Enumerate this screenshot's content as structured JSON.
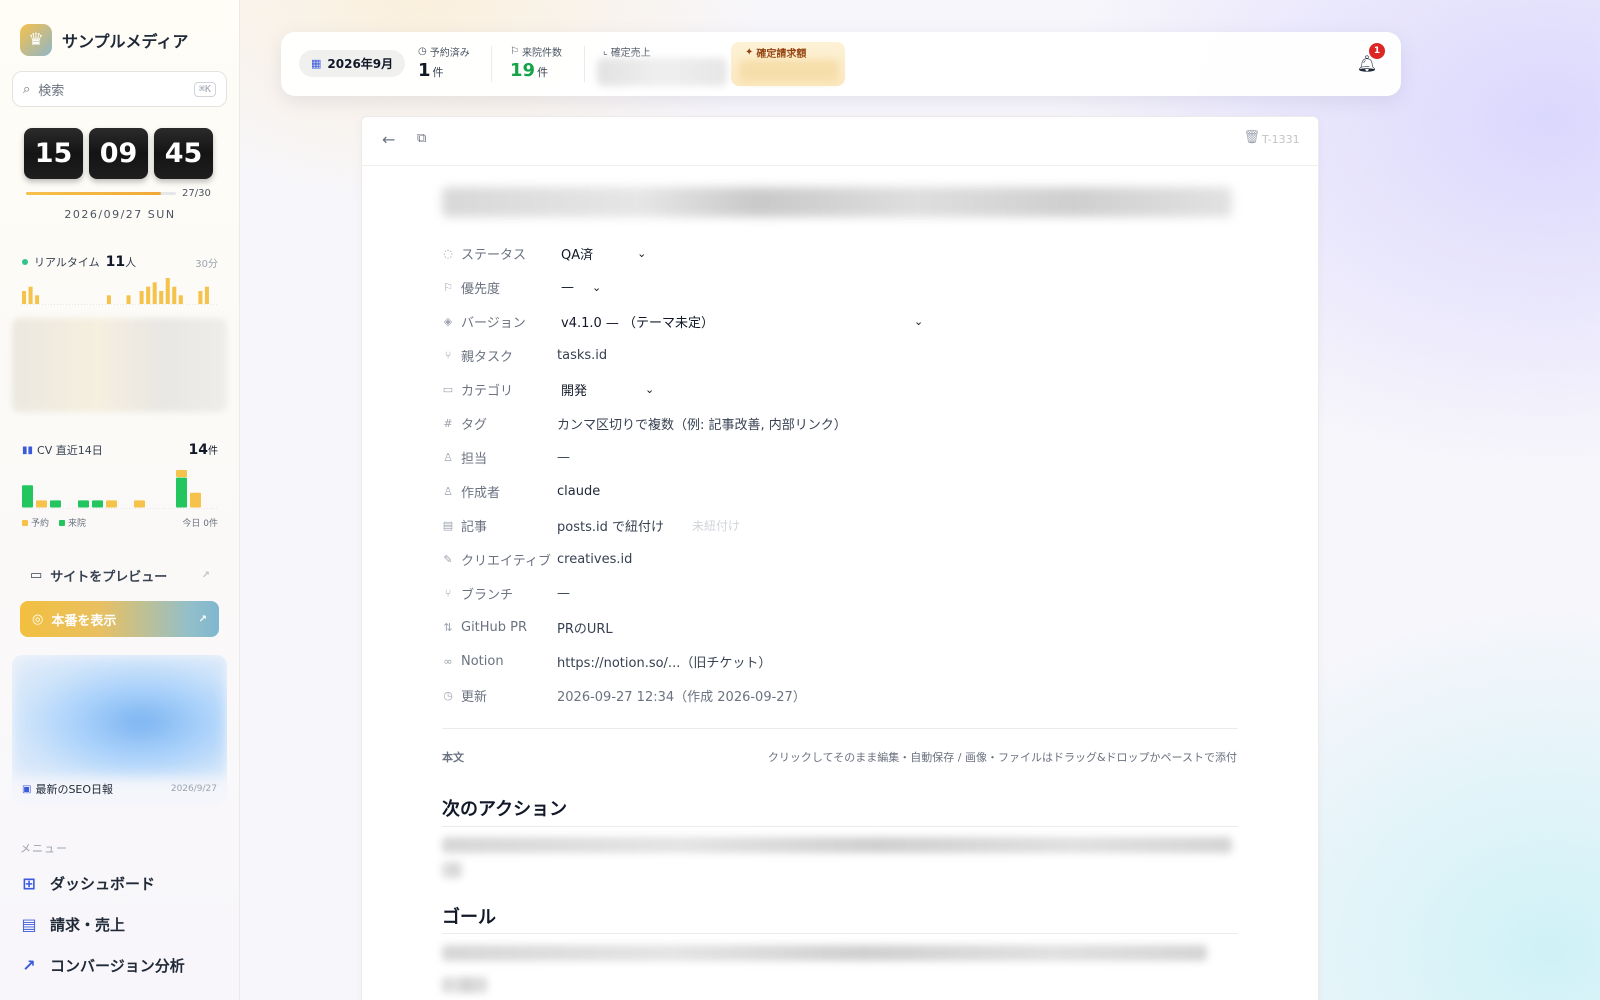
{
  "brand": {
    "name": "サンプルメディア"
  },
  "search": {
    "placeholder": "検索",
    "shortcut": "⌘K"
  },
  "clock": {
    "hours": "15",
    "minutes": "09",
    "seconds": "45"
  },
  "month_progress": {
    "label": "27/30",
    "fraction": 0.9
  },
  "date": "2026/09/27 SUN",
  "realtime": {
    "label": "リアルタイム",
    "count": "11",
    "unit": "人",
    "window": "30分",
    "color": "#f5c24c",
    "bars": [
      3,
      4,
      2,
      0,
      0,
      0,
      0,
      0,
      0,
      0,
      0,
      0,
      0,
      2,
      0,
      0,
      2,
      0,
      3,
      4,
      5,
      3,
      6,
      4,
      2,
      0,
      0,
      3,
      4,
      0
    ]
  },
  "cv": {
    "label": "CV 直近14日",
    "total": "14",
    "unit": "件",
    "legend_reserve": "予約",
    "legend_visit": "来院",
    "today_label": "今日 0件",
    "reserve_color": "#f5c24c",
    "visit_color": "#22c55e",
    "days": [
      {
        "visit": 3,
        "reserve": 0
      },
      {
        "visit": 0,
        "reserve": 1
      },
      {
        "visit": 1,
        "reserve": 0
      },
      {
        "visit": 0,
        "reserve": 0
      },
      {
        "visit": 1,
        "reserve": 0
      },
      {
        "visit": 1,
        "reserve": 0
      },
      {
        "visit": 0,
        "reserve": 1
      },
      {
        "visit": 0,
        "reserve": 0
      },
      {
        "visit": 0,
        "reserve": 1
      },
      {
        "visit": 0,
        "reserve": 0
      },
      {
        "visit": 0,
        "reserve": 0
      },
      {
        "visit": 4,
        "reserve": 1
      },
      {
        "visit": 0,
        "reserve": 2
      },
      {
        "visit": 0,
        "reserve": 0
      }
    ]
  },
  "site_preview": {
    "label": "サイトをプレビュー"
  },
  "production": {
    "label": "本番を表示"
  },
  "seo_card": {
    "title": "最新のSEO日報",
    "date": "2026/9/27"
  },
  "menu": {
    "label": "メニュー",
    "items": [
      {
        "label": "ダッシュボード",
        "icon": "grid-icon"
      },
      {
        "label": "請求・売上",
        "icon": "invoice-icon"
      },
      {
        "label": "コンバージョン分析",
        "icon": "chart-line-icon"
      }
    ]
  },
  "topbar": {
    "month": "2026年9月",
    "reserved": {
      "label": "予約済み",
      "value": "1",
      "unit": "件"
    },
    "visits": {
      "label": "来院件数",
      "value": "19",
      "unit": "件"
    },
    "confirmed_sales": {
      "label": "確定売上"
    },
    "confirmed_billing": {
      "label": "確定請求額"
    },
    "notifications": "1"
  },
  "task": {
    "id": "T-1331",
    "props": [
      {
        "key": "status",
        "label": "ステータス",
        "icon": "status-icon",
        "value": "QA済",
        "type": "select"
      },
      {
        "key": "priority",
        "label": "優先度",
        "icon": "flag-icon",
        "value": "—",
        "type": "select"
      },
      {
        "key": "version",
        "label": "バージョン",
        "icon": "layers-icon",
        "value": "v4.1.0 — （テーマ未定）",
        "type": "select"
      },
      {
        "key": "parent",
        "label": "親タスク",
        "icon": "parent-task-icon",
        "value": "tasks.id",
        "type": "text"
      },
      {
        "key": "category",
        "label": "カテゴリ",
        "icon": "folder-icon",
        "value": "開発",
        "type": "select"
      },
      {
        "key": "tags",
        "label": "タグ",
        "icon": "hash-icon",
        "value": "カンマ区切りで複数（例: 記事改善, 内部リンク）",
        "type": "text"
      },
      {
        "key": "assignee",
        "label": "担当",
        "icon": "user-icon",
        "value": "—",
        "type": "text"
      },
      {
        "key": "author",
        "label": "作成者",
        "icon": "author-icon",
        "value": "claude",
        "type": "text"
      },
      {
        "key": "article",
        "label": "記事",
        "icon": "article-icon",
        "value": "posts.id で紐付け",
        "type": "text",
        "extra": "未紐付け"
      },
      {
        "key": "creative",
        "label": "クリエイティブ",
        "icon": "brush-icon",
        "value": "creatives.id",
        "type": "text"
      },
      {
        "key": "branch",
        "label": "ブランチ",
        "icon": "branch-icon",
        "value": "—",
        "type": "text"
      },
      {
        "key": "pr",
        "label": "GitHub PR",
        "icon": "pull-request-icon",
        "value": "PRのURL",
        "type": "text"
      },
      {
        "key": "notion",
        "label": "Notion",
        "icon": "link-icon",
        "value": "https://notion.so/...（旧チケット）",
        "type": "text"
      },
      {
        "key": "updated",
        "label": "更新",
        "icon": "clock-icon",
        "value": "2026-09-27 12:34（作成 2026-09-27）",
        "type": "text"
      }
    ],
    "body_label": "本文",
    "body_hint": "クリックしてそのまま編集・自動保存 / 画像・ファイルはドラッグ&ドロップかペーストで添付",
    "heading_next": "次のアクション",
    "heading_goal": "ゴール"
  }
}
